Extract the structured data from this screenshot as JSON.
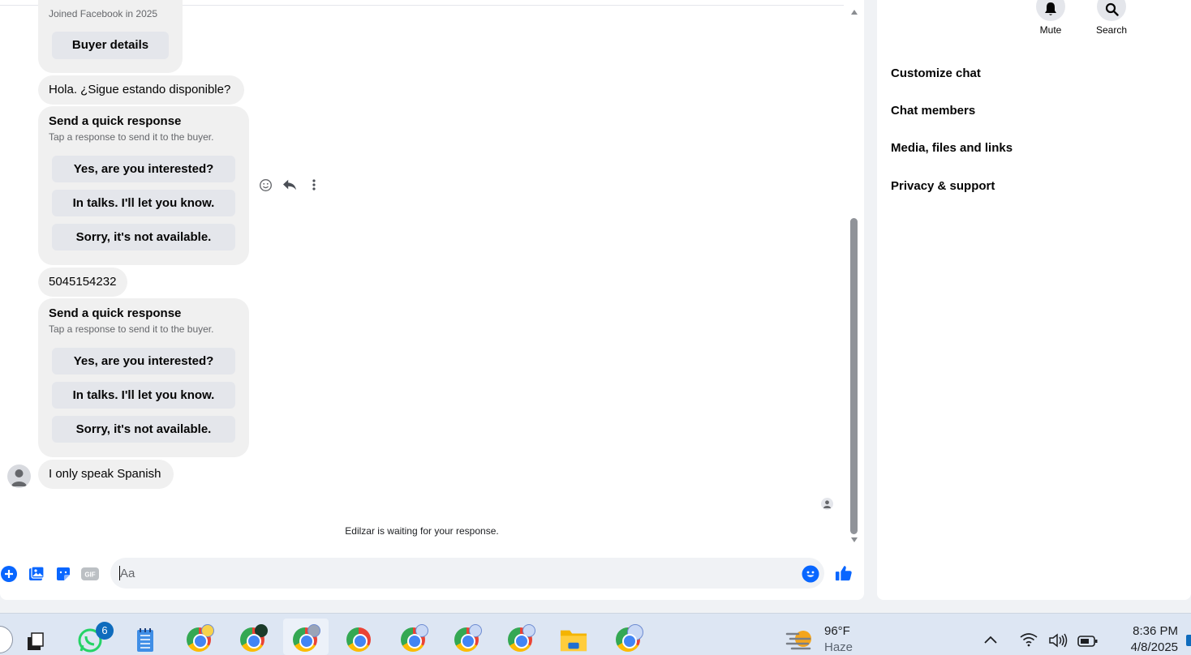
{
  "chat": {
    "joined_text": "Joined Facebook in 2025",
    "buyer_details_label": "Buyer details",
    "message_hola": "Hola. ¿Sigue estando disponible?",
    "quick_response_1": {
      "title": "Send a quick response",
      "subtitle": "Tap a response to send it to the buyer.",
      "options": [
        "Yes, are you interested?",
        "In talks. I'll let you know.",
        "Sorry, it's not available."
      ]
    },
    "message_phone": "5045154232",
    "quick_response_2": {
      "title": "Send a quick response",
      "subtitle": "Tap a response to send it to the buyer.",
      "options": [
        "Yes, are you interested?",
        "In talks. I'll let you know.",
        "Sorry, it's not available."
      ]
    },
    "message_spanish": "I only speak Spanish",
    "waiting_text": "Edilzar is waiting for your response."
  },
  "composer": {
    "placeholder": "Aa",
    "gif_label": "GIF"
  },
  "info_panel": {
    "actions": [
      {
        "label": "Mute",
        "icon": "bell-icon"
      },
      {
        "label": "Search",
        "icon": "search-icon"
      }
    ],
    "menu": [
      "Customize chat",
      "Chat members",
      "Media, files and links",
      "Privacy & support"
    ]
  },
  "taskbar": {
    "whatsapp_badge": "6",
    "weather_temp": "96°F",
    "weather_desc": "Haze",
    "time": "8:36 PM",
    "date": "4/8/2025"
  },
  "colors": {
    "messenger_blue": "#0866ff",
    "bubble_grey": "#f0f0f0",
    "button_grey": "#e4e6eb"
  }
}
